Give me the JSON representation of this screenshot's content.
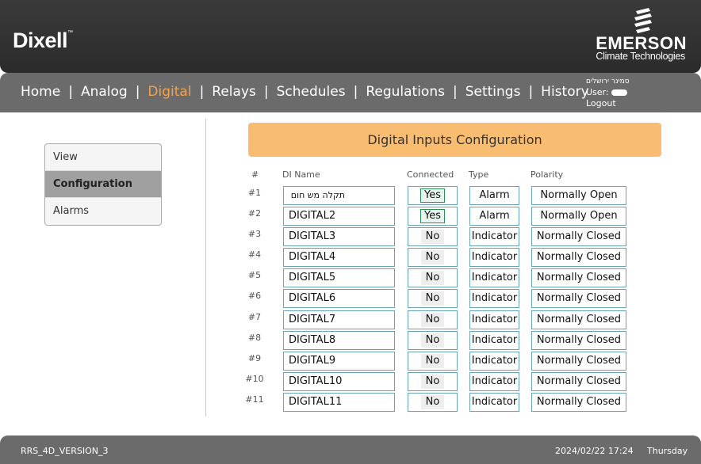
{
  "brand": {
    "left_logo": "Dixell",
    "left_logo_tm": "™",
    "right_logo_name": "EMERSON",
    "right_logo_sub": "Climate Technologies"
  },
  "nav": {
    "items": [
      "Home",
      "Analog",
      "Digital",
      "Relays",
      "Schedules",
      "Regulations",
      "Settings",
      "History"
    ],
    "separator": "|",
    "active": "Digital",
    "active_color": "#f5a14a"
  },
  "user": {
    "site": "סמינר ירושלים",
    "label": "User:",
    "logout": "Logout"
  },
  "sidebar": {
    "items": [
      "View",
      "Configuration",
      "Alarms"
    ],
    "active": "Configuration"
  },
  "page_title": "Digital Inputs Configuration",
  "table": {
    "headers": {
      "num": "#",
      "name": "DI Name",
      "connected": "Connected",
      "type": "Type",
      "polarity": "Polarity"
    },
    "rows": [
      {
        "num": "#1",
        "name": "תקלה מש חום",
        "connected": "Yes",
        "type": "Alarm",
        "polarity": "Normally Open"
      },
      {
        "num": "#2",
        "name": "DIGITAL2",
        "connected": "Yes",
        "type": "Alarm",
        "polarity": "Normally Open"
      },
      {
        "num": "#3",
        "name": "DIGITAL3",
        "connected": "No",
        "type": "Indicator",
        "polarity": "Normally Closed"
      },
      {
        "num": "#4",
        "name": "DIGITAL4",
        "connected": "No",
        "type": "Indicator",
        "polarity": "Normally Closed"
      },
      {
        "num": "#5",
        "name": "DIGITAL5",
        "connected": "No",
        "type": "Indicator",
        "polarity": "Normally Closed"
      },
      {
        "num": "#6",
        "name": "DIGITAL6",
        "connected": "No",
        "type": "Indicator",
        "polarity": "Normally Closed"
      },
      {
        "num": "#7",
        "name": "DIGITAL7",
        "connected": "No",
        "type": "Indicator",
        "polarity": "Normally Closed"
      },
      {
        "num": "#8",
        "name": "DIGITAL8",
        "connected": "No",
        "type": "Indicator",
        "polarity": "Normally Closed"
      },
      {
        "num": "#9",
        "name": "DIGITAL9",
        "connected": "No",
        "type": "Indicator",
        "polarity": "Normally Closed"
      },
      {
        "num": "#10",
        "name": "DIGITAL10",
        "connected": "No",
        "type": "Indicator",
        "polarity": "Normally Closed"
      },
      {
        "num": "#11",
        "name": "DIGITAL11",
        "connected": "No",
        "type": "Indicator",
        "polarity": "Normally Closed"
      }
    ]
  },
  "footer": {
    "version": "RRS_4D_VERSION_3",
    "datetime": "2024/02/22 17:24",
    "day": "Thursday"
  },
  "colors": {
    "title_bar": "#f9bd71",
    "header_bg": "#2f2f2f",
    "nav_bg": "#6b6b6b",
    "cell_border": "#6aa3b5"
  }
}
